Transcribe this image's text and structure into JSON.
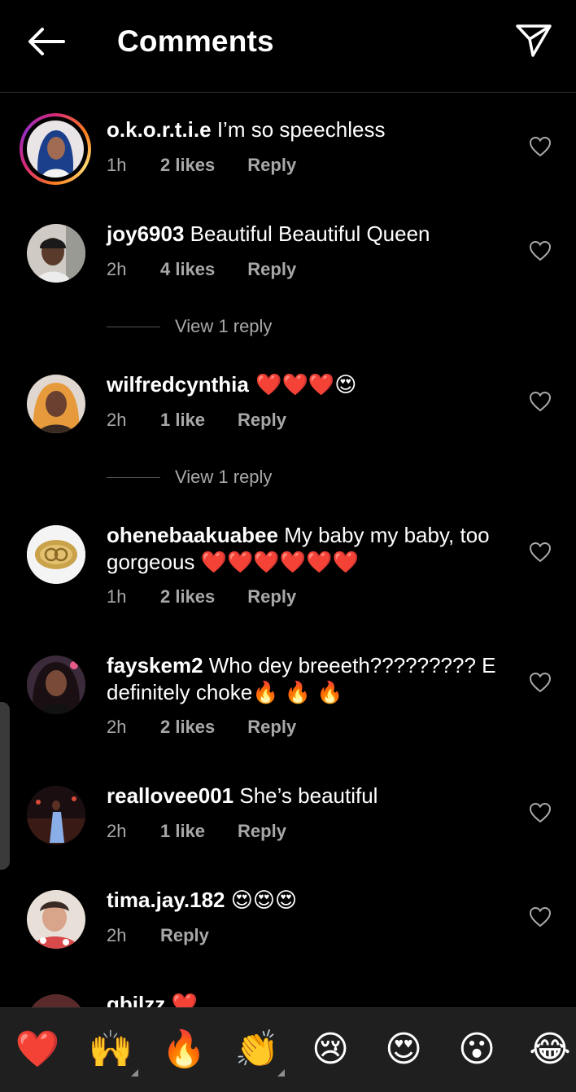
{
  "header": {
    "title": "Comments"
  },
  "comments": [
    {
      "username": "o.k.o.r.t.i.e",
      "text": " I’m so speechless",
      "time": "1h",
      "likes": "2 likes",
      "reply": "Reply"
    },
    {
      "username": "joy6903",
      "text": " Beautiful Beautiful Queen",
      "time": "2h",
      "likes": "4 likes",
      "reply": "Reply",
      "view_replies": "View 1 reply"
    },
    {
      "username": "wilfredcynthia",
      "text": " ❤️❤️❤️😍",
      "time": "2h",
      "likes": "1 like",
      "reply": "Reply",
      "view_replies": "View 1 reply"
    },
    {
      "username": "ohenebaakuabee",
      "text": " My baby my baby, too gorgeous ❤️❤️❤️❤️❤️❤️",
      "time": "1h",
      "likes": "2 likes",
      "reply": "Reply"
    },
    {
      "username": "fayskem2",
      "text": " Who dey breeeth????????? E definitely choke🔥 🔥 🔥",
      "time": "2h",
      "likes": "2 likes",
      "reply": "Reply"
    },
    {
      "username": "reallovee001",
      "text": " She’s  beautiful",
      "time": "2h",
      "likes": "1 like",
      "reply": "Reply"
    },
    {
      "username": "tima.jay.182",
      "text": " 😍😍😍",
      "time": "2h",
      "likes": "",
      "reply": "Reply"
    },
    {
      "username": "gbilzz",
      "text": " ❤️"
    }
  ],
  "emoji_bar": [
    "❤️",
    "🙌",
    "🔥",
    "👏",
    "😢",
    "😍",
    "😮",
    "😂"
  ],
  "colors": {
    "background": "#000000",
    "secondary_text": "#a8a8a8",
    "emoji_bar": "#1f1f1f",
    "divider": "#262626"
  },
  "icons": [
    "back-arrow-icon",
    "send-icon",
    "heart-outline-icon"
  ]
}
